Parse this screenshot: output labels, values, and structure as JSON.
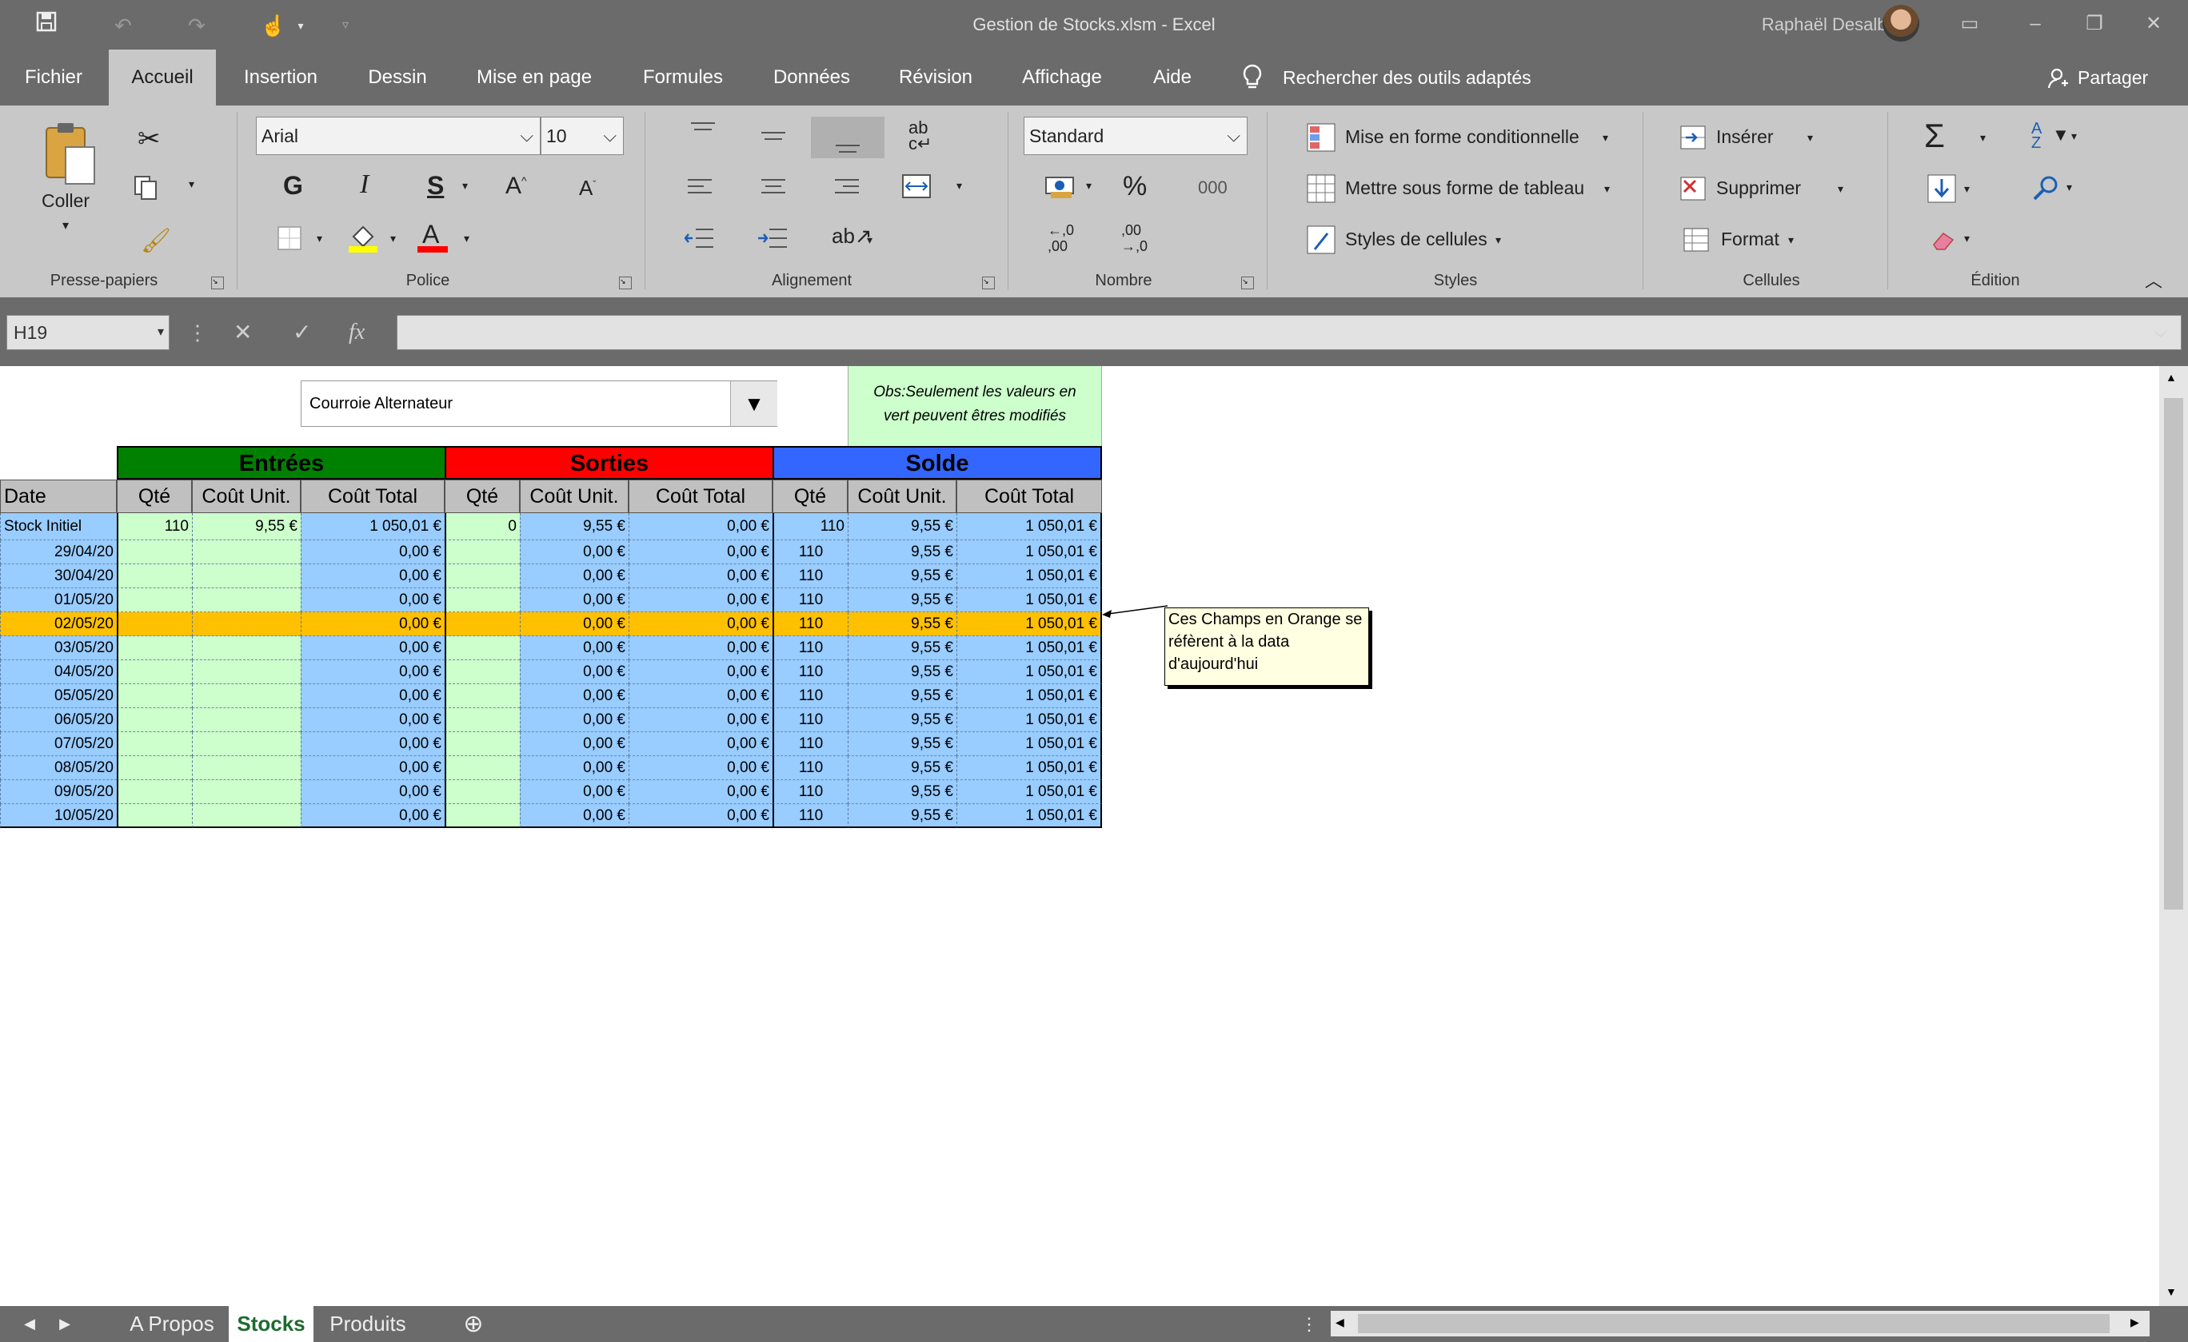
{
  "app": {
    "window_title": "Gestion de Stocks.xlsm  -  Excel",
    "user_name": "Raphaël Desalbres"
  },
  "ribbon_tabs": [
    "Fichier",
    "Accueil",
    "Insertion",
    "Dessin",
    "Mise en page",
    "Formules",
    "Données",
    "Révision",
    "Affichage",
    "Aide"
  ],
  "active_tab": "Accueil",
  "tell_me": "Rechercher des outils adaptés",
  "share": "Partager",
  "ribbon": {
    "clipboard": {
      "label": "Presse-papiers",
      "paste": "Coller"
    },
    "font": {
      "label": "Police",
      "font_name": "Arial",
      "font_size": "10",
      "bold": "G",
      "italic": "I",
      "underline": "S"
    },
    "alignment": {
      "label": "Alignement"
    },
    "number": {
      "label": "Nombre",
      "format": "Standard",
      "percent": "%",
      "thousands": "000",
      "inc_decimal": "←,0\n,00",
      "dec_decimal": ",00\n→,0"
    },
    "styles": {
      "label": "Styles",
      "conditional": "Mise en forme conditionnelle",
      "table": "Mettre sous forme de tableau",
      "cell_styles": "Styles de cellules"
    },
    "cells": {
      "label": "Cellules",
      "insert": "Insérer",
      "delete": "Supprimer",
      "format": "Format"
    },
    "editing": {
      "label": "Édition"
    }
  },
  "formula_bar": {
    "name_box": "H19",
    "formula": ""
  },
  "sheet": {
    "dropdown_value": "Courroie Alternateur",
    "obs_note": [
      "Obs:Seulement les valeurs en",
      "vert peuvent êtres modifiés"
    ],
    "group_headers": {
      "entrees": "Entrées",
      "sorties": "Sorties",
      "solde": "Solde"
    },
    "col_headers": [
      "Date",
      "Qté",
      "Coût Unit.",
      "Coût Total",
      "Qté",
      "Coût Unit.",
      "Coût Total",
      "Qté",
      "Coût Unit.",
      "Coût Total"
    ],
    "rows": [
      [
        "Stock Initiel",
        "110",
        "9,55 €",
        "1 050,01 €",
        "0",
        "9,55 €",
        "0,00 €",
        "110",
        "9,55 €",
        "1 050,01 €"
      ],
      [
        "29/04/20",
        "",
        "",
        "0,00 €",
        "",
        "0,00 €",
        "0,00 €",
        "110",
        "9,55 €",
        "1 050,01 €"
      ],
      [
        "30/04/20",
        "",
        "",
        "0,00 €",
        "",
        "0,00 €",
        "0,00 €",
        "110",
        "9,55 €",
        "1 050,01 €"
      ],
      [
        "01/05/20",
        "",
        "",
        "0,00 €",
        "",
        "0,00 €",
        "0,00 €",
        "110",
        "9,55 €",
        "1 050,01 €"
      ],
      [
        "02/05/20",
        "",
        "",
        "0,00 €",
        "",
        "0,00 €",
        "0,00 €",
        "110",
        "9,55 €",
        "1 050,01 €"
      ],
      [
        "03/05/20",
        "",
        "",
        "0,00 €",
        "",
        "0,00 €",
        "0,00 €",
        "110",
        "9,55 €",
        "1 050,01 €"
      ],
      [
        "04/05/20",
        "",
        "",
        "0,00 €",
        "",
        "0,00 €",
        "0,00 €",
        "110",
        "9,55 €",
        "1 050,01 €"
      ],
      [
        "05/05/20",
        "",
        "",
        "0,00 €",
        "",
        "0,00 €",
        "0,00 €",
        "110",
        "9,55 €",
        "1 050,01 €"
      ],
      [
        "06/05/20",
        "",
        "",
        "0,00 €",
        "",
        "0,00 €",
        "0,00 €",
        "110",
        "9,55 €",
        "1 050,01 €"
      ],
      [
        "07/05/20",
        "",
        "",
        "0,00 €",
        "",
        "0,00 €",
        "0,00 €",
        "110",
        "9,55 €",
        "1 050,01 €"
      ],
      [
        "08/05/20",
        "",
        "",
        "0,00 €",
        "",
        "0,00 €",
        "0,00 €",
        "110",
        "9,55 €",
        "1 050,01 €"
      ],
      [
        "09/05/20",
        "",
        "",
        "0,00 €",
        "",
        "0,00 €",
        "0,00 €",
        "110",
        "9,55 €",
        "1 050,01 €"
      ],
      [
        "10/05/20",
        "",
        "",
        "0,00 €",
        "",
        "0,00 €",
        "0,00 €",
        "110",
        "9,55 €",
        "1 050,01 €"
      ]
    ],
    "today_row_index": 4,
    "comment_lines": [
      "Ces Champs en Orange se",
      "réfèrent à la data",
      "d'aujourd'hui"
    ]
  },
  "sheet_tabs": [
    "A Propos",
    "Stocks",
    "Produits"
  ],
  "active_sheet": "Stocks",
  "colors": {
    "entrees_header": "#008000",
    "sorties_header": "#ff0000",
    "solde_header": "#3366ff",
    "editable_green": "#ccffcc",
    "computed_blue": "#99ccff",
    "today_orange": "#ffc000",
    "gray_header": "#c0c0c0"
  }
}
